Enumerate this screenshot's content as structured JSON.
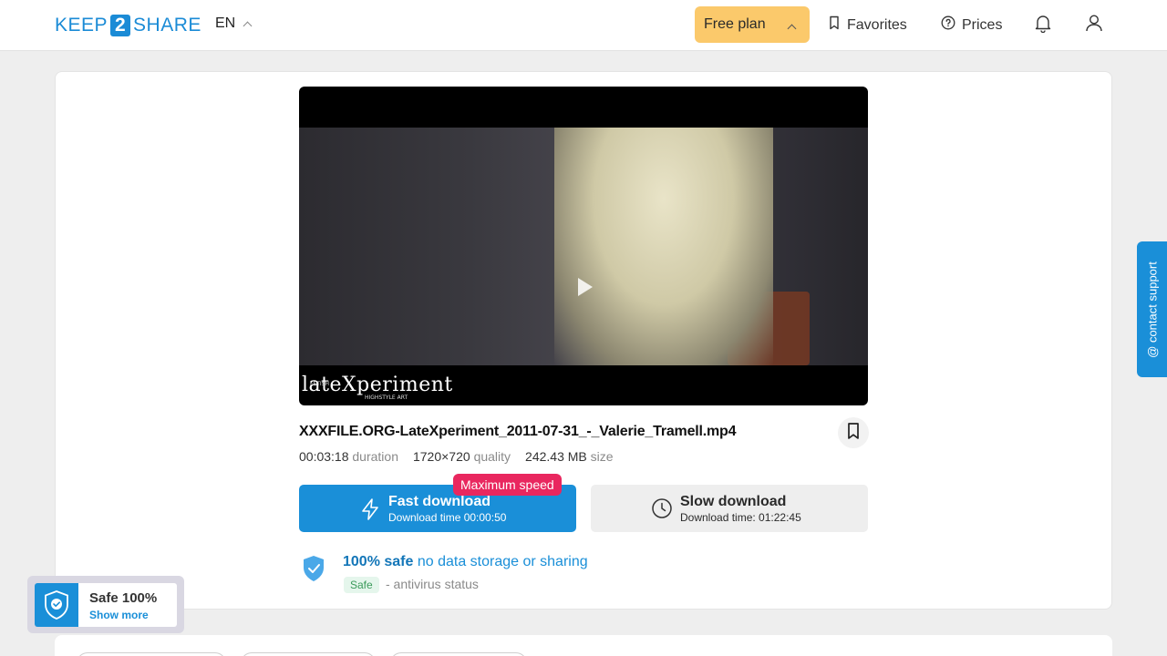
{
  "header": {
    "logo_left": "KEEP",
    "logo_mid": "2",
    "logo_right": "SHARE",
    "language": "EN",
    "plan_label": "Free plan",
    "favorites_label": "Favorites",
    "prices_label": "Prices"
  },
  "video": {
    "watermark_small": "FETISH",
    "watermark_main": "lateXperiment",
    "watermark_sub": "HIGHSTYLE ART"
  },
  "file": {
    "name": "XXXFILE.ORG-LateXperiment_2011-07-31_-_Valerie_Tramell.mp4",
    "duration_value": "00:03:18",
    "duration_label": "duration",
    "quality_value": "1720×720",
    "quality_label": "quality",
    "size_value": "242.43 MB",
    "size_label": "size"
  },
  "downloads": {
    "badge": "Maximum speed",
    "fast_title": "Fast download",
    "fast_sub": "Download time 00:00:50",
    "slow_title": "Slow download",
    "slow_sub": "Download time: 01:22:45"
  },
  "safety": {
    "title_strong": "100% safe",
    "title_rest": " no data storage or sharing",
    "pill": "Safe",
    "status": "- antivirus status"
  },
  "support": {
    "label": "@ contact support"
  },
  "widget": {
    "title": "Safe 100%",
    "link": "Show more"
  },
  "colors": {
    "accent": "#1a8fd8",
    "plan": "#fbc96b",
    "badge": "#e9275f"
  }
}
